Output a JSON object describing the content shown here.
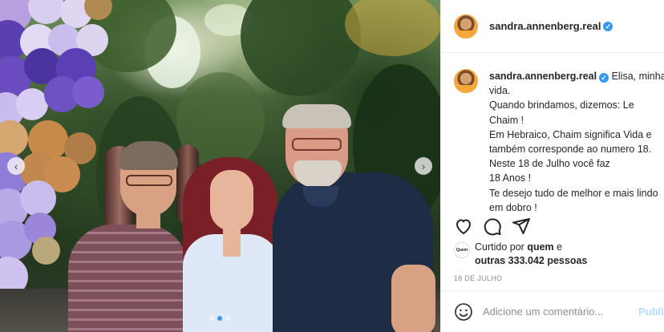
{
  "post": {
    "username": "sandra.annenberg.real",
    "caption_lines": [
      "Elisa, minha",
      "vida.",
      "Quando brindamos, dizemos: Le",
      "Chaim !",
      "Em Hebraico, Chaim significa Vida e",
      "também corresponde ao numero 18.",
      "Neste 18 de Julho você faz",
      "18 Anos !",
      "Te desejo tudo de melhor e mais lindo",
      "em dobro !"
    ],
    "likes_prefix": "Curtido por",
    "likes_user": "quem",
    "likes_connector": "e",
    "likes_others": "outras 333.042 pessoas",
    "liker_avatar_text": "Quem",
    "date": "18 DE JULHO"
  },
  "comment": {
    "placeholder": "Adicione um comentário...",
    "publish_label": "Publi"
  },
  "carousel": {
    "prev_glyph": "‹",
    "next_glyph": "›",
    "dots": 3,
    "active_dot": 1
  },
  "icons": {
    "verified": "verified-badge-icon",
    "like": "heart-icon",
    "comment": "comment-icon",
    "share": "paper-plane-icon",
    "save": "bookmark-icon",
    "emoji": "emoji-icon"
  },
  "colors": {
    "accent": "#3897f0",
    "publish_disabled": "#b2dffc",
    "muted": "#8e8e8e"
  }
}
